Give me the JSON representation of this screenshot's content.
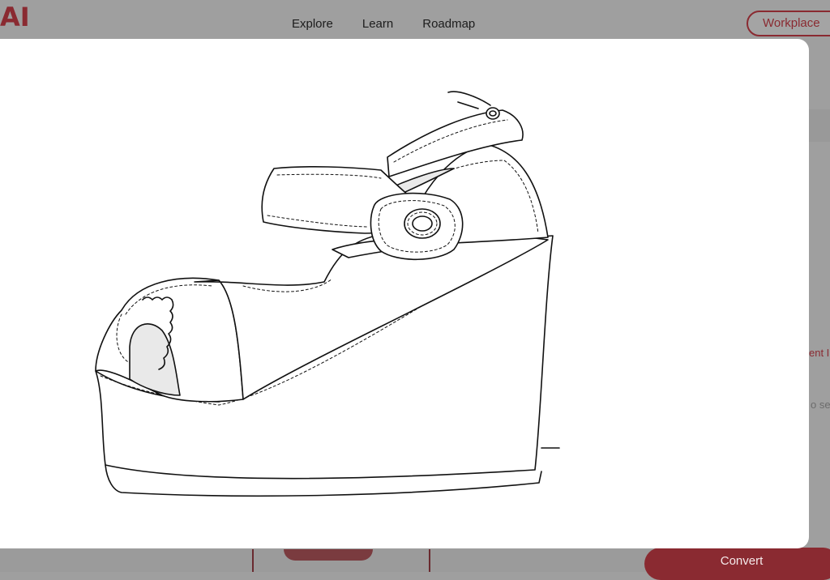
{
  "brand": {
    "logo_text": "AI",
    "accent_color": "#8a2a31"
  },
  "nav": {
    "links": [
      "Explore",
      "Learn",
      "Roadmap"
    ],
    "workplace_label": "Workplace"
  },
  "background": {
    "partial_text_1": "ent I",
    "partial_text_2": "o se",
    "convert_label": "Convert"
  },
  "modal": {
    "image_subject": "shoe-line-drawing"
  }
}
